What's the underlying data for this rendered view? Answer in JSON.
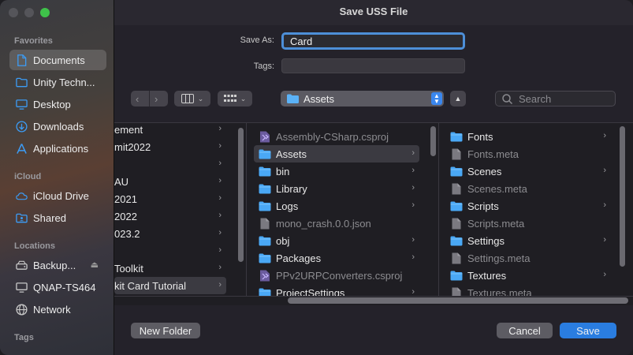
{
  "window": {
    "title": "Save USS File"
  },
  "sidebar": {
    "favorites_header": "Favorites",
    "favorites": [
      {
        "label": "Documents",
        "icon": "document-icon",
        "active": true
      },
      {
        "label": "Unity Techn...",
        "icon": "folder-icon"
      },
      {
        "label": "Desktop",
        "icon": "desktop-icon"
      },
      {
        "label": "Downloads",
        "icon": "download-icon"
      },
      {
        "label": "Applications",
        "icon": "applications-icon"
      }
    ],
    "icloud_header": "iCloud",
    "icloud": [
      {
        "label": "iCloud Drive",
        "icon": "cloud-icon"
      },
      {
        "label": "Shared",
        "icon": "shared-folder-icon"
      }
    ],
    "locations_header": "Locations",
    "locations": [
      {
        "label": "Backup...",
        "icon": "drive-icon"
      },
      {
        "label": "QNAP-TS464",
        "icon": "monitor-icon"
      },
      {
        "label": "Network",
        "icon": "network-icon"
      }
    ],
    "tags_header": "Tags"
  },
  "form": {
    "save_as_label": "Save As:",
    "save_as_value": "Card",
    "tags_label": "Tags:",
    "tags_value": ""
  },
  "toolbar": {
    "location": "Assets",
    "search_placeholder": "Search"
  },
  "columns": [
    {
      "items": [
        {
          "label": "ement",
          "chevron": true
        },
        {
          "label": "mit2022",
          "chevron": true
        },
        {
          "label": "",
          "chevron": true
        },
        {
          "label": "AU",
          "chevron": true
        },
        {
          "label": "2021",
          "chevron": true
        },
        {
          "label": "2022",
          "chevron": true
        },
        {
          "label": "023.2",
          "chevron": true
        },
        {
          "label": "",
          "chevron": true
        },
        {
          "label": "Toolkit",
          "chevron": true
        },
        {
          "label": "kit Card Tutorial",
          "chevron": true,
          "selected": true
        }
      ]
    },
    {
      "items": [
        {
          "label": "Assembly-CSharp.csproj",
          "type": "vs-file",
          "dim": true
        },
        {
          "label": "Assets",
          "type": "folder",
          "chevron": true,
          "selected": true
        },
        {
          "label": "bin",
          "type": "folder",
          "chevron": true
        },
        {
          "label": "Library",
          "type": "folder",
          "chevron": true
        },
        {
          "label": "Logs",
          "type": "folder",
          "chevron": true
        },
        {
          "label": "mono_crash.0.0.json",
          "type": "file",
          "dim": true
        },
        {
          "label": "obj",
          "type": "folder",
          "chevron": true
        },
        {
          "label": "Packages",
          "type": "folder",
          "chevron": true
        },
        {
          "label": "PPv2URPConverters.csproj",
          "type": "vs-file",
          "dim": true
        },
        {
          "label": "ProjectSettings",
          "type": "folder",
          "chevron": true
        }
      ]
    },
    {
      "items": [
        {
          "label": "Fonts",
          "type": "folder",
          "chevron": true
        },
        {
          "label": "Fonts.meta",
          "type": "file",
          "dim": true
        },
        {
          "label": "Scenes",
          "type": "folder",
          "chevron": true
        },
        {
          "label": "Scenes.meta",
          "type": "file",
          "dim": true
        },
        {
          "label": "Scripts",
          "type": "folder",
          "chevron": true
        },
        {
          "label": "Scripts.meta",
          "type": "file",
          "dim": true
        },
        {
          "label": "Settings",
          "type": "folder",
          "chevron": true
        },
        {
          "label": "Settings.meta",
          "type": "file",
          "dim": true
        },
        {
          "label": "Textures",
          "type": "folder",
          "chevron": true
        },
        {
          "label": "Textures.meta",
          "type": "file",
          "dim": true
        }
      ]
    }
  ],
  "footer": {
    "new_folder": "New Folder",
    "cancel": "Cancel",
    "save": "Save"
  },
  "colors": {
    "accent": "#2a7de0",
    "folder": "#3c9cf5",
    "vs_purple": "#8b6fd6"
  }
}
